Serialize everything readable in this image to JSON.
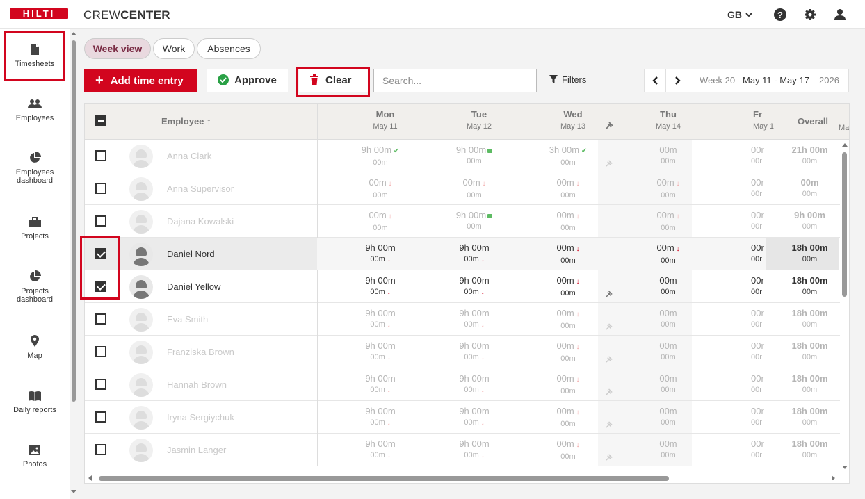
{
  "header": {
    "logo": "HILTI",
    "brand_light": "CREW",
    "brand_bold": "CENTER",
    "country": "GB",
    "help_icon": "question-circle-icon",
    "settings_icon": "gear-icon",
    "user_icon": "user-icon"
  },
  "sidebar": {
    "items": [
      {
        "label": "Timesheets",
        "icon": "document-icon"
      },
      {
        "label": "Employees",
        "icon": "people-icon"
      },
      {
        "label": "Employees dashboard",
        "icon": "pie-chart-icon"
      },
      {
        "label": "Projects",
        "icon": "briefcase-icon"
      },
      {
        "label": "Projects dashboard",
        "icon": "pie-chart-icon"
      },
      {
        "label": "Map",
        "icon": "map-pin-icon"
      },
      {
        "label": "Daily reports",
        "icon": "book-icon"
      },
      {
        "label": "Photos",
        "icon": "image-icon"
      }
    ]
  },
  "tabs": [
    "Week view",
    "Work",
    "Absences"
  ],
  "toolbar": {
    "add_label": "Add time entry",
    "approve_label": "Approve",
    "clear_label": "Clear",
    "search_placeholder": "Search...",
    "filters_label": "Filters"
  },
  "week": {
    "label": "Week 20",
    "range": "May 11 - May 17",
    "year": "2026"
  },
  "table": {
    "employee_header": "Employee",
    "overall_header": "Overall",
    "days": [
      {
        "name": "Mon",
        "date": "May 11"
      },
      {
        "name": "Tue",
        "date": "May 12"
      },
      {
        "name": "Wed",
        "date": "May 13"
      },
      {
        "name": "Thu",
        "date": "May 14"
      },
      {
        "name": "Fr",
        "date": "May 1"
      }
    ],
    "partial_next": "Ma",
    "rows": [
      {
        "name": "Anna Clark",
        "checked": false,
        "mon": "9h 00m",
        "mon_sub": "00m",
        "tue": "9h 00m",
        "tue_sub": "00m",
        "wed": "3h 00m",
        "wed_sub": "00m",
        "thu": "00m",
        "thu_sub": "00m",
        "fri": "00r",
        "fri_sub": "00r",
        "overall": "21h 00m",
        "overall_sub": "00m"
      },
      {
        "name": "Anna Supervisor",
        "checked": false,
        "mon": "00m",
        "mon_sub": "00m",
        "tue": "00m",
        "tue_sub": "00m",
        "wed": "00m",
        "wed_sub": "00m",
        "thu": "00m",
        "thu_sub": "00m",
        "fri": "00r",
        "fri_sub": "00r",
        "overall": "00m",
        "overall_sub": "00m"
      },
      {
        "name": "Dajana Kowalski",
        "checked": false,
        "mon": "00m",
        "mon_sub": "00m",
        "tue": "9h 00m",
        "tue_sub": "00m",
        "wed": "00m",
        "wed_sub": "00m",
        "thu": "00m",
        "thu_sub": "00m",
        "fri": "00r",
        "fri_sub": "00r",
        "overall": "9h 00m",
        "overall_sub": "00m"
      },
      {
        "name": "Daniel Nord",
        "checked": true,
        "mon": "9h 00m",
        "mon_sub": "00m",
        "tue": "9h 00m",
        "tue_sub": "00m",
        "wed": "00m",
        "wed_sub": "00m",
        "thu": "00m",
        "thu_sub": "00m",
        "fri": "00r",
        "fri_sub": "00r",
        "overall": "18h 00m",
        "overall_sub": "00m"
      },
      {
        "name": "Daniel Yellow",
        "checked": true,
        "mon": "9h 00m",
        "mon_sub": "00m",
        "tue": "9h 00m",
        "tue_sub": "00m",
        "wed": "00m",
        "wed_sub": "00m",
        "thu": "00m",
        "thu_sub": "00m",
        "fri": "00r",
        "fri_sub": "00r",
        "overall": "18h 00m",
        "overall_sub": "00m"
      },
      {
        "name": "Eva Smith",
        "checked": false,
        "mon": "9h 00m",
        "mon_sub": "00m",
        "tue": "9h 00m",
        "tue_sub": "00m",
        "wed": "00m",
        "wed_sub": "00m",
        "thu": "00m",
        "thu_sub": "00m",
        "fri": "00r",
        "fri_sub": "00r",
        "overall": "18h 00m",
        "overall_sub": "00m"
      },
      {
        "name": "Franziska Brown",
        "checked": false,
        "mon": "9h 00m",
        "mon_sub": "00m",
        "tue": "9h 00m",
        "tue_sub": "00m",
        "wed": "00m",
        "wed_sub": "00m",
        "thu": "00m",
        "thu_sub": "00m",
        "fri": "00r",
        "fri_sub": "00r",
        "overall": "18h 00m",
        "overall_sub": "00m"
      },
      {
        "name": "Hannah Brown",
        "checked": false,
        "mon": "9h 00m",
        "mon_sub": "00m",
        "tue": "9h 00m",
        "tue_sub": "00m",
        "wed": "00m",
        "wed_sub": "00m",
        "thu": "00m",
        "thu_sub": "00m",
        "fri": "00r",
        "fri_sub": "00r",
        "overall": "18h 00m",
        "overall_sub": "00m"
      },
      {
        "name": "Iryna Sergiychuk",
        "checked": false,
        "mon": "9h 00m",
        "mon_sub": "00m",
        "tue": "9h 00m",
        "tue_sub": "00m",
        "wed": "00m",
        "wed_sub": "00m",
        "thu": "00m",
        "thu_sub": "00m",
        "fri": "00r",
        "fri_sub": "00r",
        "overall": "18h 00m",
        "overall_sub": "00m"
      },
      {
        "name": "Jasmin Langer",
        "checked": false,
        "mon": "9h 00m",
        "mon_sub": "00m",
        "tue": "9h 00m",
        "tue_sub": "00m",
        "wed": "00m",
        "wed_sub": "00m",
        "thu": "00m",
        "thu_sub": "00m",
        "fri": "00r",
        "fri_sub": "00r",
        "overall": "18h 00m",
        "overall_sub": "00m"
      }
    ]
  },
  "colors": {
    "brand": "#d2051e",
    "ok": "#5dbb63",
    "warn_arrow": "#d2051e"
  }
}
